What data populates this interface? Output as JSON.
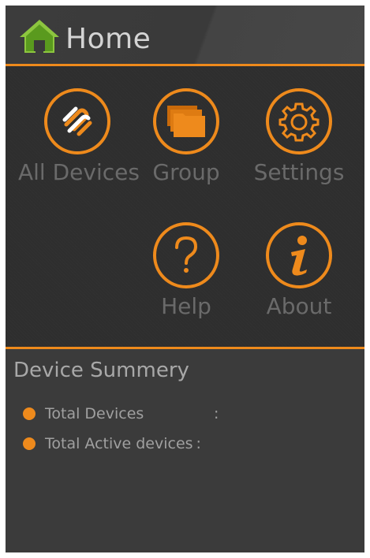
{
  "header": {
    "title": "Home",
    "icon": "home-icon"
  },
  "menu": {
    "items": [
      {
        "label": "All Devices",
        "icon": "all-devices-icon"
      },
      {
        "label": "Group",
        "icon": "folders-icon"
      },
      {
        "label": "Settings",
        "icon": "gear-icon"
      },
      {
        "label": "Help",
        "icon": "question-icon"
      },
      {
        "label": "About",
        "icon": "info-icon"
      }
    ]
  },
  "summary": {
    "title": "Device Summery",
    "rows": [
      {
        "label": "Total Devices",
        "colon": ":"
      },
      {
        "label": "Total Active devices",
        "colon": ":"
      }
    ]
  },
  "colors": {
    "accent": "#ee8a1c",
    "home_icon": "#8dc63f"
  }
}
